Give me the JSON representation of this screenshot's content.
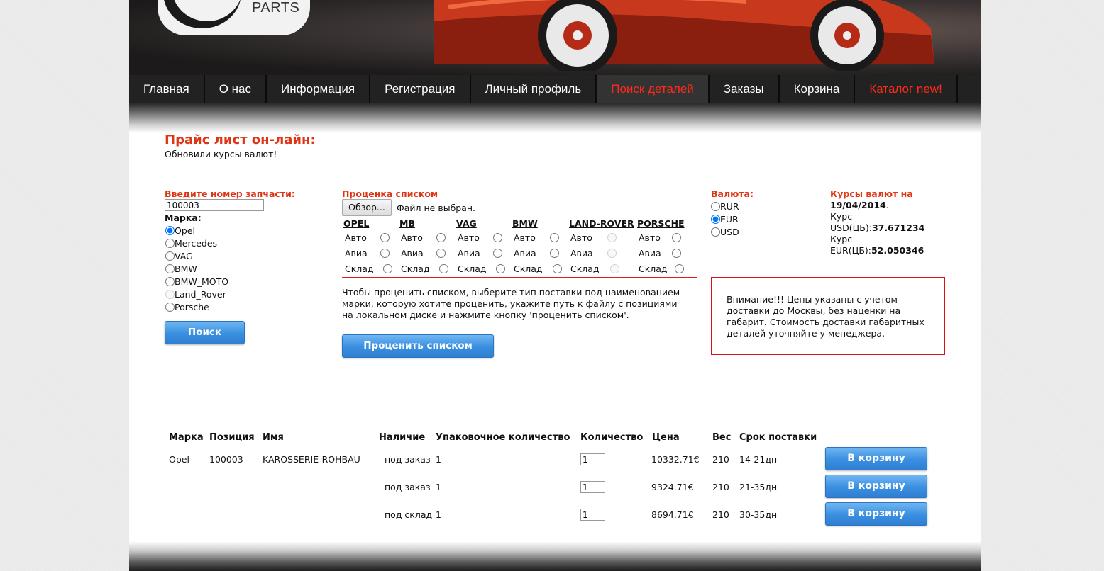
{
  "header": {
    "logo_text": "PARTS"
  },
  "nav": [
    {
      "label": "Главная",
      "style": "normal"
    },
    {
      "label": "О нас",
      "style": "normal"
    },
    {
      "label": "Информация",
      "style": "normal"
    },
    {
      "label": "Регистрация",
      "style": "normal"
    },
    {
      "label": "Личный профиль",
      "style": "normal"
    },
    {
      "label": "Поиск деталей",
      "style": "active"
    },
    {
      "label": "Заказы",
      "style": "normal"
    },
    {
      "label": "Корзина",
      "style": "normal"
    },
    {
      "label": "Каталог new!",
      "style": "red"
    }
  ],
  "page": {
    "title": "Прайс лист он-лайн:",
    "subtitle": "Обновили курсы валют!"
  },
  "search": {
    "part_label": "Введите номер запчасти:",
    "part_value": "100003",
    "brand_label": "Марка:",
    "brands": [
      {
        "label": "Opel",
        "checked": true,
        "disabled": false
      },
      {
        "label": "Mercedes",
        "checked": false,
        "disabled": false
      },
      {
        "label": "VAG",
        "checked": false,
        "disabled": false
      },
      {
        "label": "BMW",
        "checked": false,
        "disabled": false
      },
      {
        "label": "BMW_MOTO",
        "checked": false,
        "disabled": false
      },
      {
        "label": "Land_Rover",
        "checked": false,
        "disabled": true
      },
      {
        "label": "Porsche",
        "checked": false,
        "disabled": false
      }
    ],
    "button": "Поиск"
  },
  "bulk": {
    "label": "Проценка списком",
    "browse": "Обзор...",
    "file_status": "Файл не выбран.",
    "suppliers": [
      {
        "name": "OPEL",
        "options": [
          "Авто",
          "Авиа",
          "Склад"
        ],
        "disabled": false
      },
      {
        "name": "MB",
        "options": [
          "Авто",
          "Авиа",
          "Склад"
        ],
        "disabled": false
      },
      {
        "name": "VAG",
        "options": [
          "Авто",
          "Авиа",
          "Склад"
        ],
        "disabled": false
      },
      {
        "name": "BMW",
        "options": [
          "Авто",
          "Авиа",
          "Склад"
        ],
        "disabled": false
      },
      {
        "name": "LAND-ROVER",
        "options": [
          "Авто",
          "Авиа",
          "Склад"
        ],
        "disabled": true
      },
      {
        "name": "PORSCHE",
        "options": [
          "Авто",
          "Авиа",
          "Склад"
        ],
        "disabled": false
      }
    ],
    "help": "Чтобы проценить списком, выберите тип поставки под наименованием марки, которую хотите проценить, укажите путь к файлу с позициями на локальном диске и нажмите кнопку 'проценить списком'.",
    "button": "Проценить списком"
  },
  "currency": {
    "label": "Валюта:",
    "options": [
      {
        "label": "RUR",
        "checked": false
      },
      {
        "label": "EUR",
        "checked": true
      },
      {
        "label": "USD",
        "checked": false
      }
    ]
  },
  "rates": {
    "label": "Курсы валют на",
    "date": "19/04/2014",
    "usd_prefix": "Курс",
    "usd_label": "USD(ЦБ):",
    "usd_value": "37.671234",
    "eur_prefix": "Курс",
    "eur_label": "EUR(ЦБ):",
    "eur_value": "52.050346"
  },
  "notice": "Внимание!!! Цены указаны с учетом доставки до Москвы, без наценки на габарит. Стоимость доставки габаритных деталей уточняйте у менеджера.",
  "results": {
    "columns": [
      "Марка",
      "Позиция",
      "Имя",
      "Наличие",
      "Упаковочное количество",
      "Количество",
      "Цена",
      "Вес",
      "Срок поставки"
    ],
    "rows": [
      {
        "brand": "Opel",
        "position": "100003",
        "name": "KAROSSERIE-ROHBAU",
        "availability": "под заказ",
        "pack_qty": "1",
        "qty": "1",
        "price": "10332.71€",
        "weight": "210",
        "delivery": "14-21дн",
        "button": "В корзину"
      },
      {
        "brand": "",
        "position": "",
        "name": "",
        "availability": "под заказ",
        "pack_qty": "1",
        "qty": "1",
        "price": "9324.71€",
        "weight": "210",
        "delivery": "21-35дн",
        "button": "В корзину"
      },
      {
        "brand": "",
        "position": "",
        "name": "",
        "availability": "под склад",
        "pack_qty": "1",
        "qty": "1",
        "price": "8694.71€",
        "weight": "210",
        "delivery": "30-35дн",
        "button": "В корзину"
      }
    ]
  }
}
